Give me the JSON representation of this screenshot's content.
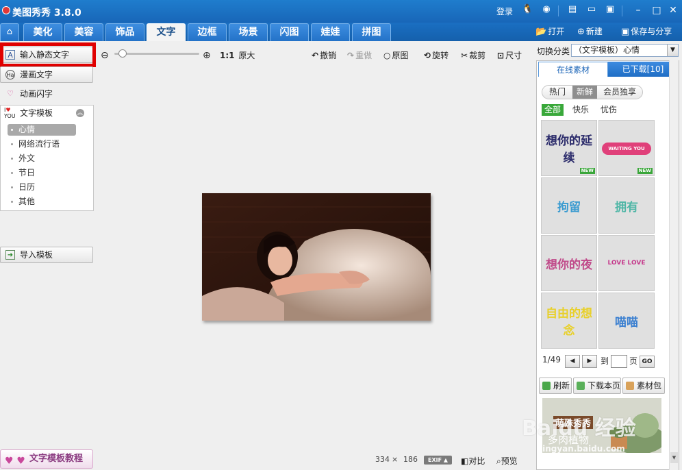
{
  "titlebar": {
    "title": "美图秀秀 3.8.0",
    "login": "登录"
  },
  "nav": {
    "tabs": [
      "美化",
      "美容",
      "饰品",
      "文字",
      "边框",
      "场景",
      "闪图",
      "娃娃",
      "拼图"
    ],
    "active_index": 3,
    "actions": {
      "open": "打开",
      "new": "新建",
      "save_share": "保存与分享"
    }
  },
  "left": {
    "static_text": "输入静态文字",
    "comic_text": "漫画文字",
    "animated_text": "动画闪字",
    "template": {
      "title": "文字模板",
      "items": [
        "心情",
        "网络流行语",
        "外文",
        "节日",
        "日历",
        "其他"
      ],
      "selected_index": 0
    },
    "import_template": "导入模板",
    "tutorial": "文字模板教程"
  },
  "toolbar": {
    "ratio": "1:1",
    "original_size": "原大",
    "undo": "撤销",
    "redo": "重做",
    "original": "原图",
    "rotate": "旋转",
    "crop": "裁剪",
    "size": "尺寸",
    "zoom_level": 0.05
  },
  "status": {
    "width": "334",
    "times": "×",
    "height": "186",
    "exif": "EXIF",
    "compare": "对比",
    "preview": "预览"
  },
  "right": {
    "switch_label": "切换分类",
    "category": "（文字模板）心情",
    "tab_online": "在线素材",
    "tab_downloaded": "已下载[10]",
    "segments": [
      "热门",
      "新鲜",
      "会员独享"
    ],
    "active_segment": 1,
    "filters": [
      "全部",
      "快乐",
      "忧伤"
    ],
    "active_filter": 0,
    "thumbnails": [
      {
        "text": "想你的延续",
        "color": "#2a2a6a",
        "badge": "NEW"
      },
      {
        "text": "WAITING YOU",
        "color": "#e0407a",
        "badge": "NEW"
      },
      {
        "text": "拘留",
        "color": "#3a9bd0"
      },
      {
        "text": "拥有",
        "color": "#4fb6a6"
      },
      {
        "text": "想你的夜",
        "color": "#c04a8a"
      },
      {
        "text": "LOVE LOVE",
        "color": "#c53a8c"
      },
      {
        "text": "自由的想念",
        "color": "#e8d02a"
      },
      {
        "text": "喵喵",
        "color": "#3a7fd0"
      }
    ],
    "page": "1/49",
    "goto": "到",
    "page_unit": "页",
    "go": "GO",
    "refresh": "刷新",
    "download_page": "下载本页",
    "material_pack": "素材包",
    "banner": {
      "line1": "萌殊秀秀",
      "line2": "多肉植物"
    }
  },
  "watermark": {
    "line1": "Baidu 经验",
    "line2": "jingyan.baidu.com"
  }
}
